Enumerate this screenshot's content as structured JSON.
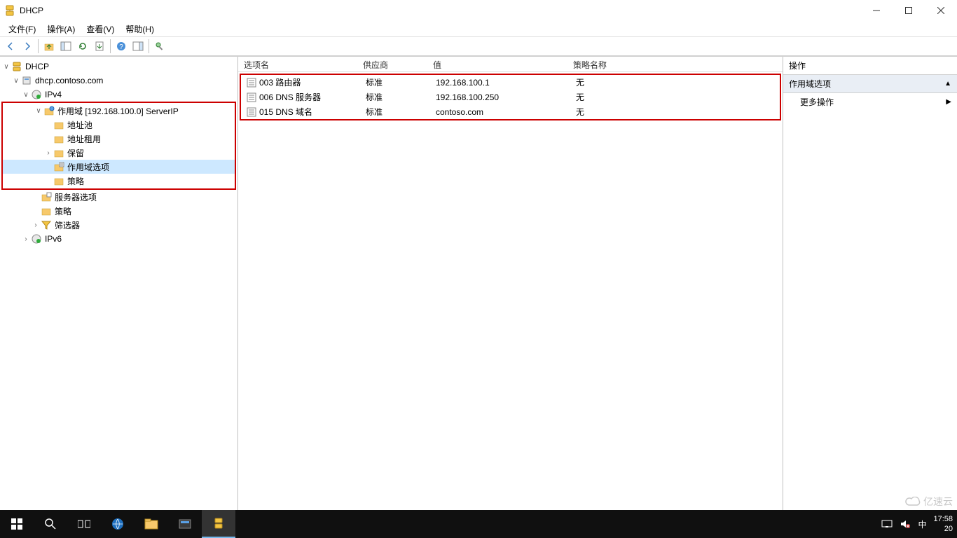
{
  "window": {
    "title": "DHCP"
  },
  "menu": {
    "file": "文件(F)",
    "action": "操作(A)",
    "view": "查看(V)",
    "help": "帮助(H)"
  },
  "tree": {
    "root": "DHCP",
    "server": "dhcp.contoso.com",
    "ipv4": "IPv4",
    "ipv6": "IPv6",
    "scope": "作用域 [192.168.100.0] ServerIP",
    "addrpool": "地址池",
    "leases": "地址租用",
    "reservations": "保留",
    "scopeoptions": "作用域选项",
    "policies": "策略",
    "serveroptions": "服务器选项",
    "srvpolicies": "策略",
    "filters": "筛选器"
  },
  "list": {
    "headers": {
      "option": "选项名",
      "vendor": "供应商",
      "value": "值",
      "policy": "策略名称"
    },
    "rows": [
      {
        "option": "003 路由器",
        "vendor": "标准",
        "value": "192.168.100.1",
        "policy": "无"
      },
      {
        "option": "006 DNS 服务器",
        "vendor": "标准",
        "value": "192.168.100.250",
        "policy": "无"
      },
      {
        "option": "015 DNS 域名",
        "vendor": "标准",
        "value": "contoso.com",
        "policy": "无"
      }
    ]
  },
  "actions": {
    "title": "操作",
    "header": "作用域选项",
    "more": "更多操作"
  },
  "tray": {
    "ime": "中",
    "time": "17:58",
    "date_prefix": "20"
  },
  "watermark": "亿速云"
}
